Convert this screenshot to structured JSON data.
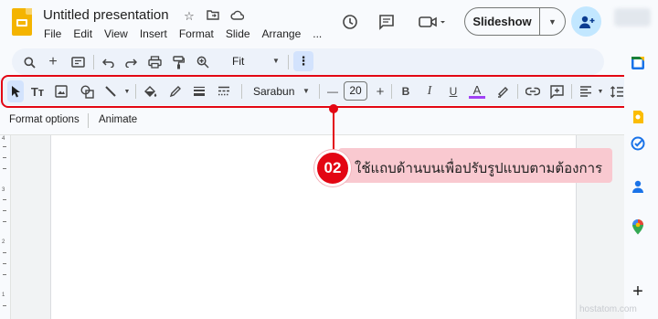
{
  "header": {
    "title": "Untitled presentation",
    "menu": [
      "File",
      "Edit",
      "View",
      "Insert",
      "Format",
      "Slide",
      "Arrange",
      "..."
    ],
    "slideshow_label": "Slideshow"
  },
  "toolbar_primary": {
    "zoom_label": "Fit"
  },
  "toolbar_format": {
    "font_name": "Sarabun",
    "font_size": "20",
    "bold": "B",
    "italic": "I",
    "underline": "U",
    "text_color_glyph": "A",
    "text_color": "#a142f4",
    "decrease": "—",
    "increase": "+"
  },
  "context_bar": {
    "format_options": "Format options",
    "animate": "Animate"
  },
  "annotation": {
    "badge": "02",
    "text": "ใช้แถบด้านบนเพื่อปรับรูปแบบตามต้องการ",
    "color": "#e30613"
  },
  "ruler": {
    "labels": [
      "4",
      "3",
      "2",
      "1"
    ]
  },
  "watermark": "hostatom.com"
}
